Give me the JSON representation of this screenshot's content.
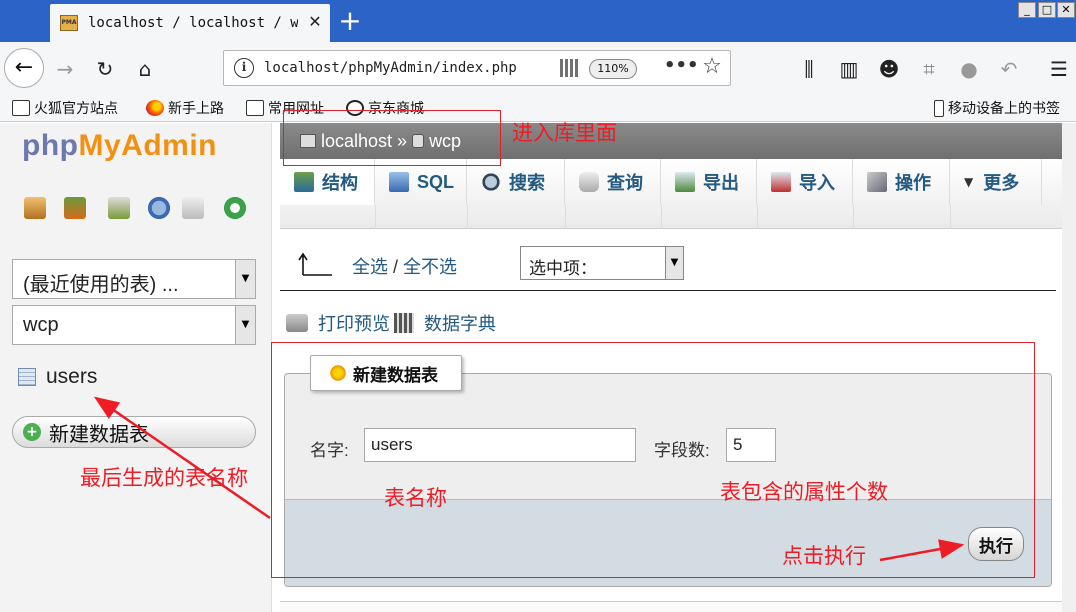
{
  "browser": {
    "tab_title": "localhost / localhost / wcp",
    "tab_close": "✕",
    "new_tab": "+",
    "url": "localhost/phpMyAdmin/index.php",
    "zoom": "110%",
    "url_more": "•••",
    "window_buttons": [
      "_",
      "□",
      "✕"
    ],
    "bookmarks": [
      "火狐官方站点",
      "新手上路",
      "常用网址",
      "京东商城"
    ],
    "mobile_bookmarks": "移动设备上的书签"
  },
  "sidebar": {
    "logo_php": "php",
    "logo_myadmin": "MyAdmin",
    "recent_tables": "(最近使用的表) ...",
    "database": "wcp",
    "tables": [
      "users"
    ],
    "new_table": "新建数据表"
  },
  "main": {
    "breadcrumb": {
      "server": "localhost",
      "separator": "»",
      "database": "wcp"
    },
    "tabs": [
      "结构",
      "SQL",
      "搜索",
      "查询",
      "导出",
      "导入",
      "操作",
      "更多"
    ],
    "check_all": "全选",
    "check_sep": " / ",
    "uncheck_all": "全不选",
    "with_selected": "选中项：",
    "print_view": "打印预览",
    "data_dictionary": "数据字典",
    "create_legend": "新建数据表",
    "name_label": "名字:",
    "name_value": "users",
    "columns_label": "字段数:",
    "columns_value": "5",
    "go_button": "执行"
  },
  "annotations": {
    "enter_db": "进入库里面",
    "generated_table_name": "最后生成的表名称",
    "table_name": "表名称",
    "column_count": "表包含的属性个数",
    "click_go": "点击执行",
    "color": "#ee1c25"
  },
  "colors": {
    "titlebar": "#2b63c6",
    "link": "#235a81",
    "logo_php": "#6c78af",
    "logo_myadmin": "#f29111"
  }
}
